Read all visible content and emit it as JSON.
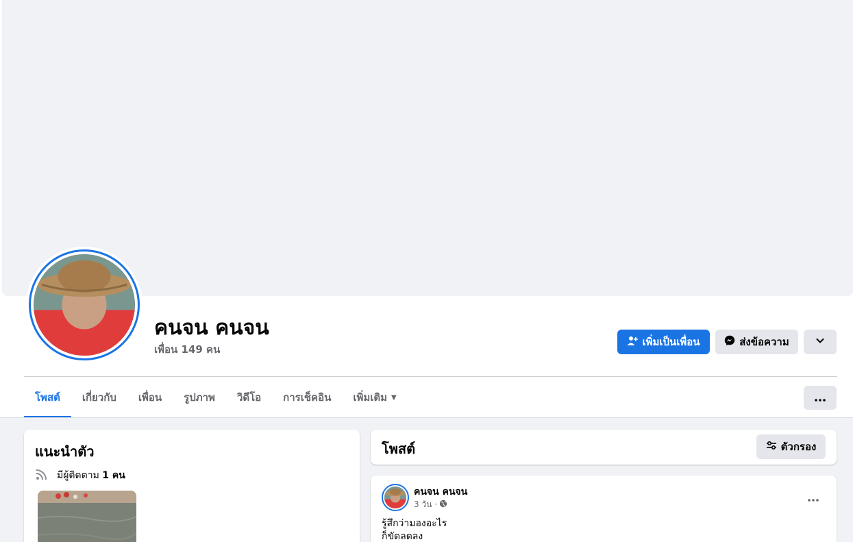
{
  "profile": {
    "name": "คนจน คนจน",
    "friends_label": "เพื่อน 149 คน"
  },
  "actions": {
    "add_friend": "เพิ่มเป็นเพื่อน",
    "message": "ส่งข้อความ"
  },
  "tabs": [
    {
      "label": "โพสต์",
      "active": true
    },
    {
      "label": "เกี่ยวกับ"
    },
    {
      "label": "เพื่อน"
    },
    {
      "label": "รูปภาพ"
    },
    {
      "label": "วิดีโอ"
    },
    {
      "label": "การเช็คอิน"
    },
    {
      "label": "เพิ่มเติม"
    }
  ],
  "intro": {
    "title": "แนะนำตัว",
    "followers_prefix": "มีผู้ติดตาม",
    "followers_count": "1 คน"
  },
  "posts_section": {
    "title": "โพสต์",
    "filter_label": "ตัวกรอง"
  },
  "post": {
    "author": "คนจน คนจน",
    "time": "3 วัน ·",
    "lines": [
      "รู้สึกว่ามองอะไร",
      "ก็ขัดลดลง"
    ]
  },
  "colors": {
    "accent": "#1b74e4",
    "page_bg": "#f0f2f5",
    "secondary_button": "#e4e6eb",
    "muted_text": "#65676b"
  },
  "icons": {
    "add_friend": "person-plus-icon",
    "message": "messenger-icon",
    "chevron": "chevron-down-icon",
    "more": "more-dots-icon",
    "followers": "rss-feed-icon",
    "filter": "filter-sliders-icon",
    "audience": "globe-icon"
  }
}
